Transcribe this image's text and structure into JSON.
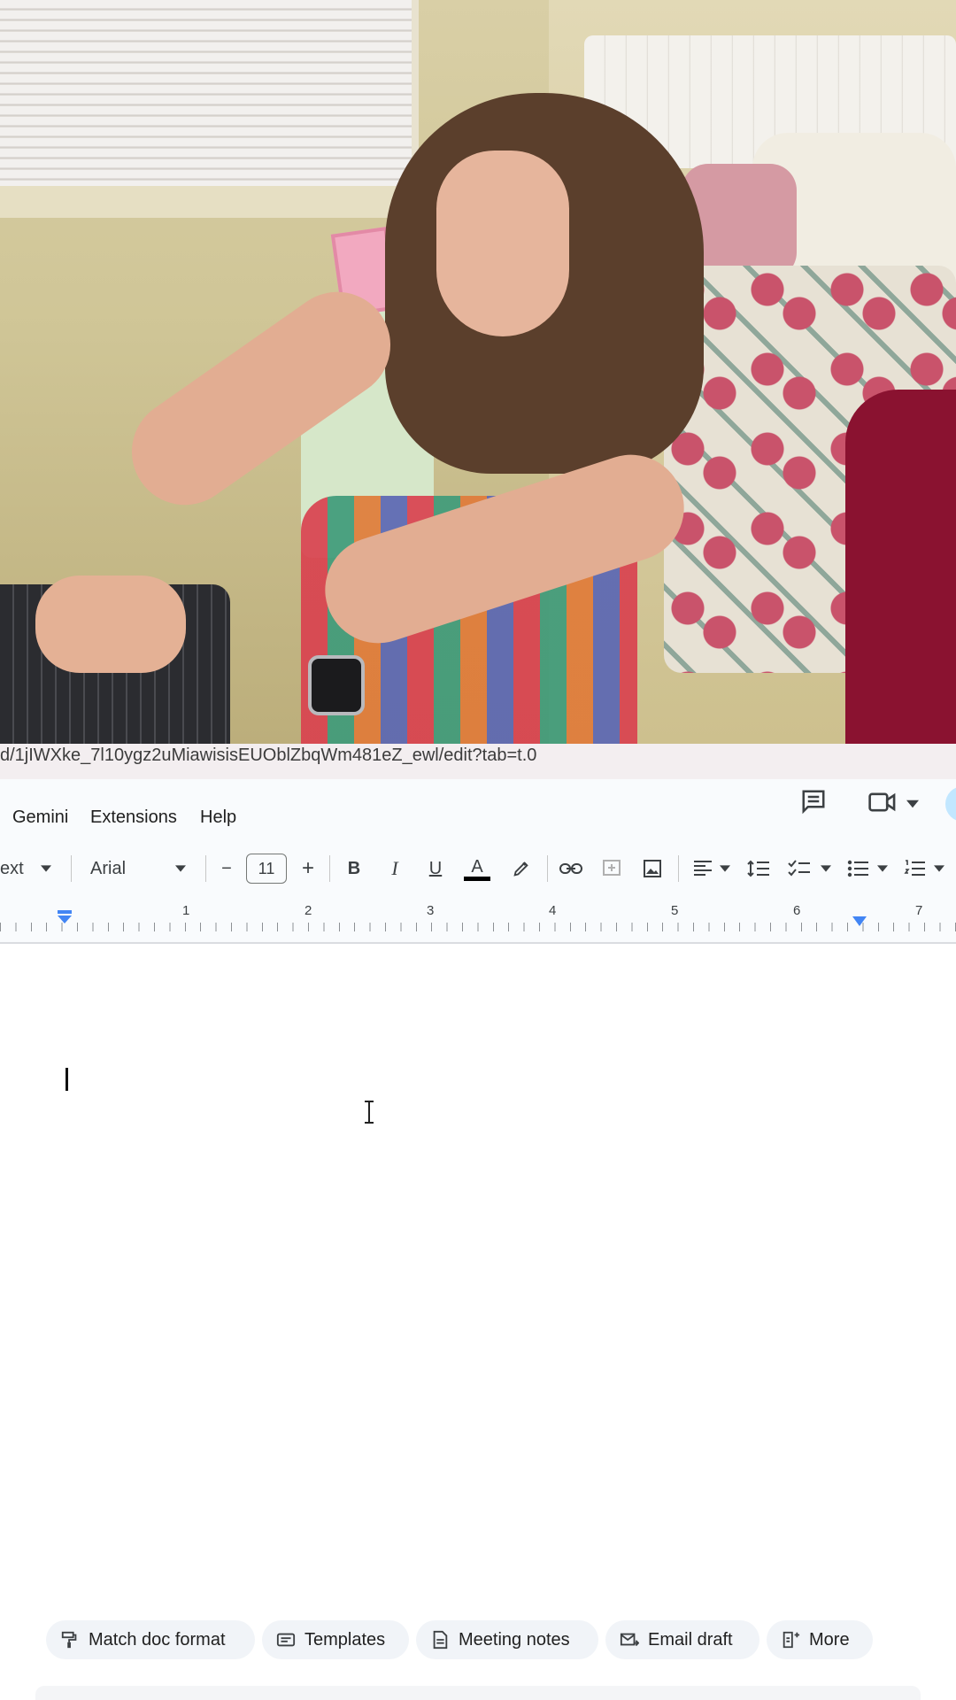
{
  "browser": {
    "url": "d/1jIWXke_7l10ygz2uMiawisisEUOblZbqWm481eZ_ewl/edit?tab=t.0"
  },
  "menubar": {
    "items": [
      "Gemini",
      "Extensions",
      "Help"
    ]
  },
  "toolbar": {
    "style_label": "ext",
    "font_name": "Arial",
    "font_size": "11",
    "decrease": "−",
    "increase": "+",
    "bold": "B",
    "italic": "I",
    "underline": "U",
    "text_color": "A"
  },
  "ruler": {
    "numbers": [
      "1",
      "2",
      "3",
      "4",
      "5",
      "6",
      "7"
    ]
  },
  "suggestions": {
    "chips": [
      "Match doc format",
      "Templates",
      "Meeting notes",
      "Email draft",
      "More"
    ]
  },
  "colors": {
    "toolbar_bg": "#f9fbfd",
    "accent_blue": "#1a73e8",
    "chip_bg": "#f1f4f8"
  }
}
